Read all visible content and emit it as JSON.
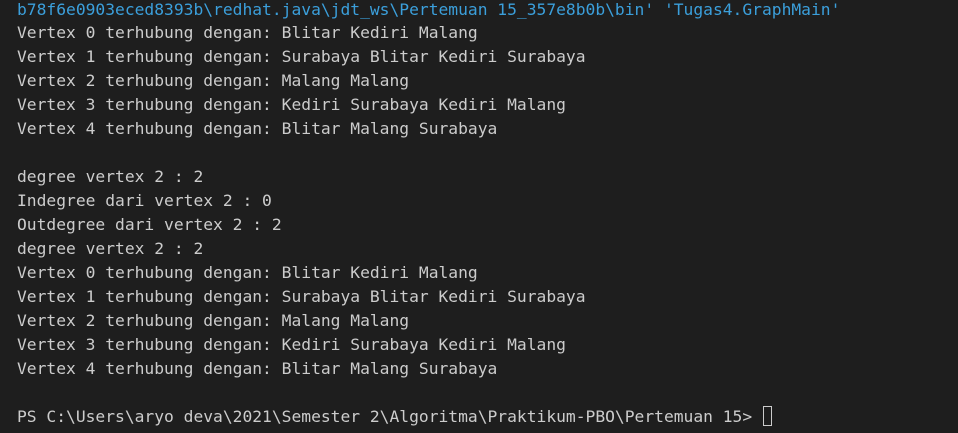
{
  "terminal": {
    "header_line": "b78f6e0903eced8393b\\redhat.java\\jdt_ws\\Pertemuan 15_357e8b0b\\bin' 'Tugas4.GraphMain'",
    "output": [
      "Vertex 0 terhubung dengan: Blitar Kediri Malang",
      "Vertex 1 terhubung dengan: Surabaya Blitar Kediri Surabaya",
      "Vertex 2 terhubung dengan: Malang Malang",
      "Vertex 3 terhubung dengan: Kediri Surabaya Kediri Malang",
      "Vertex 4 terhubung dengan: Blitar Malang Surabaya",
      "",
      "degree vertex 2 : 2",
      "Indegree dari vertex 2 : 0",
      "Outdegree dari vertex 2 : 2",
      "degree vertex 2 : 2",
      "Vertex 0 terhubung dengan: Blitar Kediri Malang",
      "Vertex 1 terhubung dengan: Surabaya Blitar Kediri Surabaya",
      "Vertex 2 terhubung dengan: Malang Malang",
      "Vertex 3 terhubung dengan: Kediri Surabaya Kediri Malang",
      "Vertex 4 terhubung dengan: Blitar Malang Surabaya",
      ""
    ],
    "prompt": "PS C:\\Users\\aryo deva\\2021\\Semester 2\\Algoritma\\Praktikum-PBO\\Pertemuan 15> ",
    "colors": {
      "background": "#1e1e1e",
      "text": "#cccccc",
      "path_text": "#3b9fdb"
    }
  }
}
